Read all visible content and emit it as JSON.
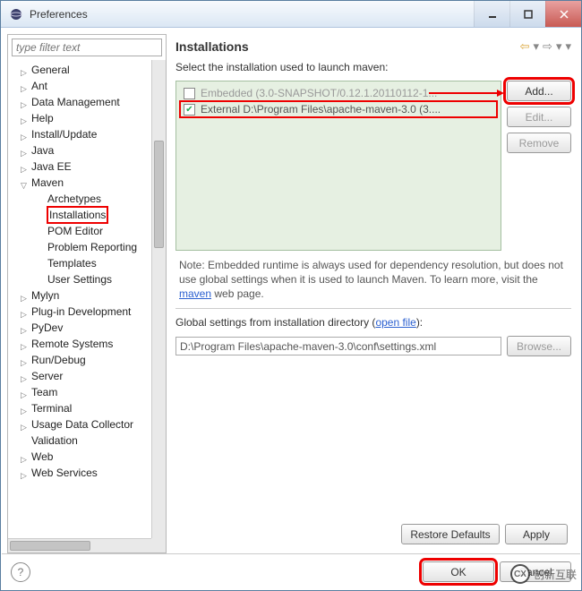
{
  "window": {
    "title": "Preferences"
  },
  "filter": {
    "placeholder": "type filter text"
  },
  "tree": {
    "top": [
      {
        "label": "General",
        "expandable": true
      },
      {
        "label": "Ant",
        "expandable": true
      },
      {
        "label": "Data Management",
        "expandable": true
      },
      {
        "label": "Help",
        "expandable": true
      },
      {
        "label": "Install/Update",
        "expandable": true
      },
      {
        "label": "Java",
        "expandable": true
      },
      {
        "label": "Java EE",
        "expandable": true
      }
    ],
    "maven": {
      "label": "Maven",
      "children": [
        {
          "label": "Archetypes"
        },
        {
          "label": "Installations",
          "highlight": true
        },
        {
          "label": "POM Editor"
        },
        {
          "label": "Problem Reporting"
        },
        {
          "label": "Templates"
        },
        {
          "label": "User Settings"
        }
      ]
    },
    "bottom": [
      {
        "label": "Mylyn",
        "expandable": true
      },
      {
        "label": "Plug-in Development",
        "expandable": true
      },
      {
        "label": "PyDev",
        "expandable": true
      },
      {
        "label": "Remote Systems",
        "expandable": true
      },
      {
        "label": "Run/Debug",
        "expandable": true
      },
      {
        "label": "Server",
        "expandable": true
      },
      {
        "label": "Team",
        "expandable": true
      },
      {
        "label": "Terminal",
        "expandable": true
      },
      {
        "label": "Usage Data Collector",
        "expandable": true
      },
      {
        "label": "Validation"
      },
      {
        "label": "Web",
        "expandable": true
      },
      {
        "label": "Web Services",
        "expandable": true
      }
    ]
  },
  "page": {
    "title": "Installations",
    "select_label": "Select the installation used to launch maven:",
    "installations": [
      {
        "checked": false,
        "label": "Embedded (3.0-SNAPSHOT/0.12.1.20110112-1..."
      },
      {
        "checked": true,
        "label": "External D:\\Program Files\\apache-maven-3.0 (3...."
      }
    ],
    "buttons": {
      "add": "Add...",
      "edit": "Edit...",
      "remove": "Remove"
    },
    "note_prefix": "Note: Embedded runtime is always used for dependency resolution, but does not use global settings when it is used to launch Maven. To learn more, visit the ",
    "note_link": "maven",
    "note_suffix": " web page.",
    "global_label_a": "Global settings from installation directory (",
    "global_link": "open file",
    "global_label_b": "):",
    "global_value": "D:\\Program Files\\apache-maven-3.0\\conf\\settings.xml",
    "browse": "Browse...",
    "restore": "Restore Defaults",
    "apply": "Apply",
    "ok": "OK",
    "cancel": "Cancel"
  },
  "watermark": {
    "logo": "CX",
    "text": "创新互联"
  }
}
